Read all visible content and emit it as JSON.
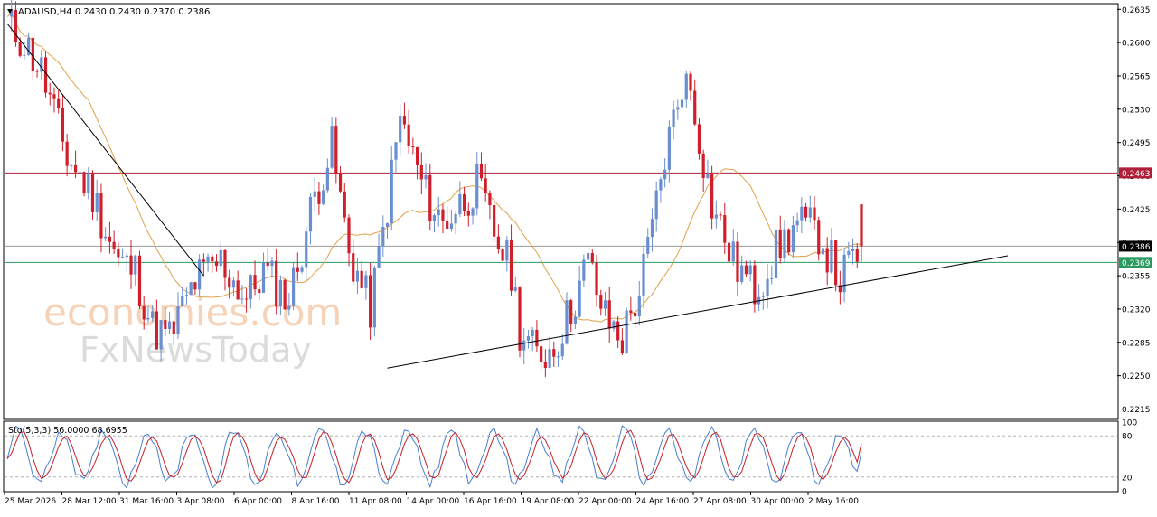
{
  "header": {
    "symbol_line": "ADAUSD,H4  0.2430 0.2430 0.2370 0.2386"
  },
  "watermark": {
    "line1": "economies.com",
    "line2": "FxNewsToday"
  },
  "colors": {
    "bull": "#6a8fd0",
    "bear": "#d01f2a",
    "ma": "#e0a24a",
    "resistance": "#b0203a",
    "support": "#2a9a60",
    "current": "#9a9a9a",
    "trendline": "#000000",
    "stoch_main": "#4a7fd0",
    "stoch_signal": "#c8202a"
  },
  "chart_data": [
    {
      "type": "candlestick",
      "title": "ADAUSD,H4",
      "ohlc_last": {
        "open": 0.243,
        "high": 0.243,
        "low": 0.237,
        "close": 0.2386
      },
      "y_ticks": [
        "0.2635",
        "0.2600",
        "0.2565",
        "0.2530",
        "0.2495",
        "0.2460",
        "0.2425",
        "0.2390",
        "0.2355",
        "0.2320",
        "0.2285",
        "0.2250",
        "0.2215"
      ],
      "ylim": [
        0.2205,
        0.264
      ],
      "x_labels": [
        "25 Mar 2026",
        "28 Mar 12:00",
        "31 Mar 16:00",
        "3 Apr 08:00",
        "6 Apr 00:00",
        "8 Apr 16:00",
        "11 Apr 08:00",
        "14 Apr 00:00",
        "16 Apr 16:00",
        "19 Apr 08:00",
        "22 Apr 00:00",
        "24 Apr 16:00",
        "27 Apr 08:00",
        "30 Apr 00:00",
        "2 May 16:00"
      ],
      "series": [
        {
          "name": "Close",
          "x": [
            0,
            4,
            8,
            14,
            20,
            26,
            30,
            34,
            38,
            40,
            44,
            50,
            56,
            60,
            66,
            72,
            76,
            80,
            85,
            88,
            92,
            95,
            98,
            102,
            106,
            110,
            114,
            118,
            120,
            124,
            128,
            132,
            136,
            140,
            144,
            148,
            150,
            154,
            158,
            160,
            165,
            170,
            175,
            180,
            185,
            190,
            195,
            200
          ],
          "values": [
            0.262,
            0.26,
            0.257,
            0.248,
            0.244,
            0.237,
            0.236,
            0.23,
            0.229,
            0.231,
            0.235,
            0.237,
            0.233,
            0.236,
            0.233,
            0.244,
            0.249,
            0.238,
            0.232,
            0.24,
            0.252,
            0.248,
            0.244,
            0.241,
            0.243,
            0.245,
            0.24,
            0.236,
            0.23,
            0.227,
            0.228,
            0.232,
            0.237,
            0.231,
            0.229,
            0.234,
            0.238,
            0.248,
            0.256,
            0.255,
            0.243,
            0.237,
            0.234,
            0.238,
            0.241,
            0.24,
            0.235,
            0.2386
          ]
        },
        {
          "name": "MA"
        }
      ],
      "levels": [
        {
          "label": "0.2463",
          "value": 0.2463,
          "role": "resistance"
        },
        {
          "label": "0.2386",
          "value": 0.2386,
          "role": "current"
        },
        {
          "label": "0.2369",
          "value": 0.2369,
          "role": "support"
        }
      ]
    },
    {
      "type": "line",
      "title": "Sto(5,3,3) 56.0000 68.6955",
      "ylim": [
        0,
        100
      ],
      "y_ticks": [
        "100",
        "80",
        "20",
        "0"
      ],
      "levels": [
        80,
        20
      ],
      "series": [
        {
          "name": "Main",
          "last": 56.0
        },
        {
          "name": "Signal",
          "last": 68.6955
        }
      ]
    }
  ]
}
